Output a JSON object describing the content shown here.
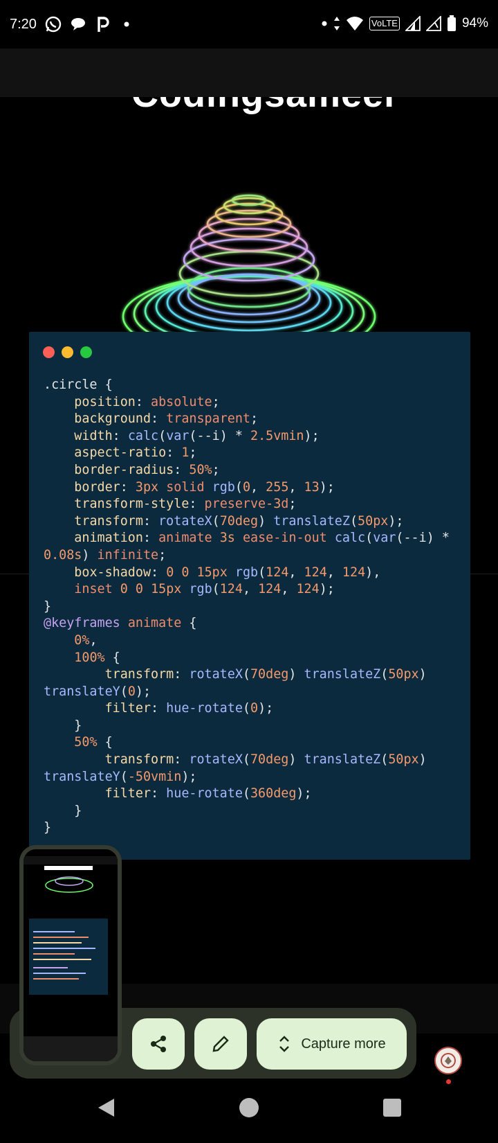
{
  "status_bar": {
    "time": "7:20",
    "left_icons": [
      "whatsapp-icon",
      "chat-icon",
      "pinterest-icon",
      "dot-icon"
    ],
    "right_icons": [
      "dot-icon",
      "data-arrows-icon",
      "wifi-icon",
      "volte-icon",
      "signal-icon",
      "signal-icon",
      "battery-icon"
    ],
    "volte": "VoLTE",
    "battery": "94%"
  },
  "page": {
    "brand_title": "Codingsameer"
  },
  "code_card": {
    "window_dots": [
      "#ff5f57",
      "#febc2e",
      "#28c840"
    ],
    "lines": [
      ".circle {",
      "    position: absolute;",
      "    background: transparent;",
      "    width: calc(var(--i) * 2.5vmin);",
      "    aspect-ratio: 1;",
      "    border-radius: 50%;",
      "    border: 3px solid rgb(0, 255, 13);",
      "    transform-style: preserve-3d;",
      "    transform: rotateX(70deg) translateZ(50px);",
      "    animation: animate 3s ease-in-out calc(var(--i) *",
      "0.08s) infinite;",
      "    box-shadow: 0 0 15px rgb(124, 124, 124),",
      "    inset 0 0 15px rgb(124, 124, 124);",
      "}",
      "@keyframes animate {",
      "    0%,",
      "    100% {",
      "        transform: rotateX(70deg) translateZ(50px)",
      "translateY(0);",
      "        filter: hue-rotate(0);",
      "    }",
      "    50% {",
      "        transform: rotateX(70deg) translateZ(50px)",
      "translateY(-50vmin);",
      "        filter: hue-rotate(360deg);",
      "    }",
      "}"
    ]
  },
  "screenshot_toolbar": {
    "share_icon": "share-icon",
    "edit_icon": "pencil-icon",
    "capture_more_icon": "expand-vertical-icon",
    "capture_more_label": "Capture more"
  },
  "colors": {
    "toolbar_bg": "#2d3228",
    "button_bg": "#dff3d4",
    "code_bg": "#0b2a3d"
  }
}
